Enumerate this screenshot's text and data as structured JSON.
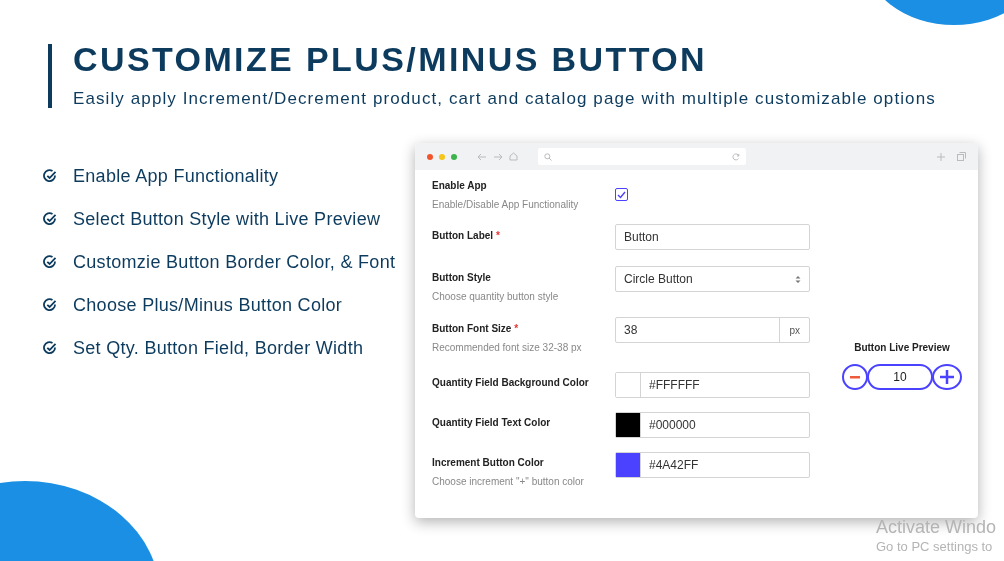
{
  "title": "CUSTOMIZE PLUS/MINUS BUTTON",
  "subtitle": "Easily apply Increment/Decrement product, cart and catalog page with multiple customizable options",
  "features": [
    "Enable App Functionality",
    "Select Button Style with Live Preview",
    "Customzie Button Border Color, & Font",
    "Choose Plus/Minus Button Color",
    "Set Qty. Button Field, Border Width"
  ],
  "settings": [
    {
      "kind": "checkbox",
      "label": "Enable App",
      "description": "Enable/Disable App Functionality",
      "checked": true
    },
    {
      "kind": "text",
      "label": "Button Label",
      "required_mark": "*",
      "value": "Button"
    },
    {
      "kind": "select",
      "label": "Button Style",
      "description": "Choose quantity button style",
      "value": "Circle Button"
    },
    {
      "kind": "number",
      "label": "Button Font Size",
      "required_mark": "*",
      "description": "Recommended font size 32-38 px",
      "value": "38",
      "unit": "px"
    },
    {
      "kind": "color",
      "label": "Quantity Field Background Color",
      "value": "#FFFFFF",
      "color": "#ffffff"
    },
    {
      "kind": "color",
      "label": "Quantity Field Text Color",
      "value": "#000000",
      "color": "#000000"
    },
    {
      "kind": "color",
      "label": "Increment Button Color",
      "description": "Choose increment \"+\" button color",
      "value": "#4A42FF",
      "color": "#4a42ff"
    }
  ],
  "preview": {
    "title": "Button Live Preview",
    "quantity": "10"
  },
  "os_notice": [
    "Activate Windo",
    "Go to PC settings to"
  ]
}
